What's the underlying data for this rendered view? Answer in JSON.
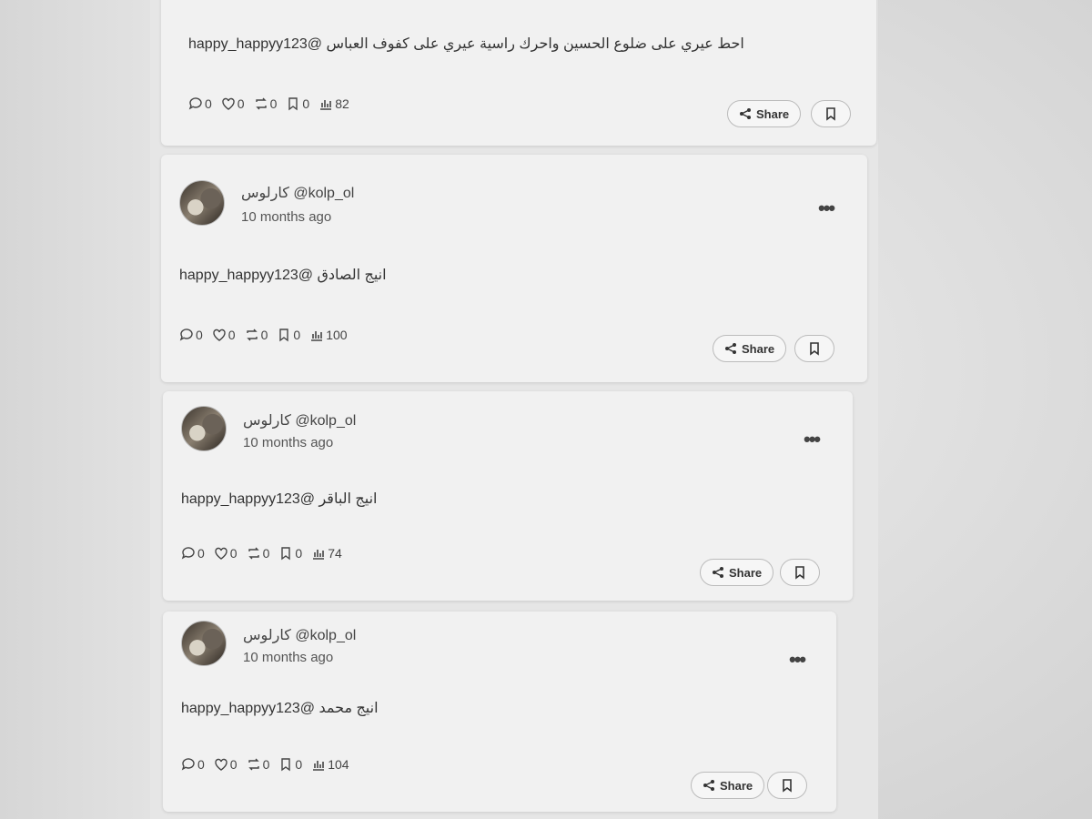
{
  "posts": [
    {
      "text": "احط عيري على ضلوع الحسين واحرك راسية عيري على كفوف العباس @happy_happyy123",
      "stats": {
        "comments": "0",
        "likes": "0",
        "reposts": "0",
        "bookmarks": "0",
        "views": "82"
      },
      "share_label": "Share"
    },
    {
      "author_name": "كارلوس",
      "author_handle": "@kolp_ol",
      "time": "10 months ago",
      "text": "انيج الصادق @happy_happyy123",
      "stats": {
        "comments": "0",
        "likes": "0",
        "reposts": "0",
        "bookmarks": "0",
        "views": "100"
      },
      "share_label": "Share"
    },
    {
      "author_name": "كارلوس",
      "author_handle": "@kolp_ol",
      "time": "10 months ago",
      "text": "انيج الباقر @happy_happyy123",
      "stats": {
        "comments": "0",
        "likes": "0",
        "reposts": "0",
        "bookmarks": "0",
        "views": "74"
      },
      "share_label": "Share"
    },
    {
      "author_name": "كارلوس",
      "author_handle": "@kolp_ol",
      "time": "10 months ago",
      "text": "انيج محمد @happy_happyy123",
      "stats": {
        "comments": "0",
        "likes": "0",
        "reposts": "0",
        "bookmarks": "0",
        "views": "104"
      },
      "share_label": "Share"
    }
  ],
  "icons": {
    "comment": "comment-icon",
    "like": "heart-icon",
    "repost": "repost-icon",
    "bookmark": "bookmark-icon",
    "views": "views-chart-icon",
    "share": "share-icon",
    "more": "more-dots-icon"
  }
}
